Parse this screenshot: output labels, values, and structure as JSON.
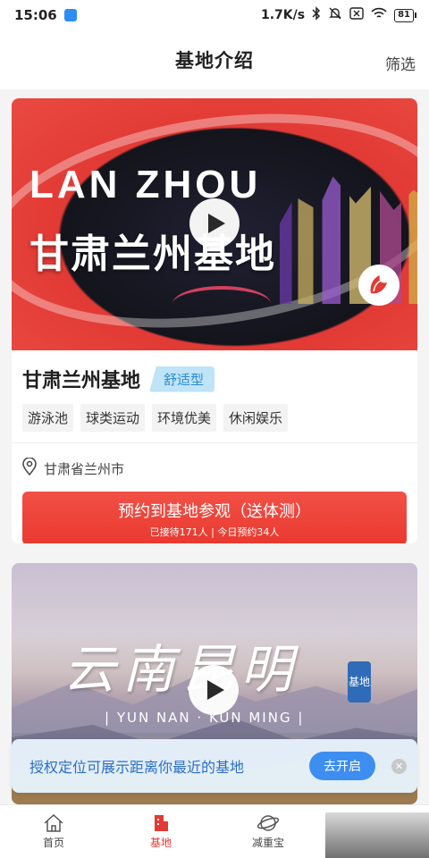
{
  "status_bar": {
    "time": "15:06",
    "net_speed": "1.7K/s",
    "battery": "81"
  },
  "header": {
    "title": "基地介绍",
    "filter_label": "筛选"
  },
  "cards": [
    {
      "image_title_en": "LAN ZHOU",
      "image_title_cn": "甘肃兰州基地",
      "name": "甘肃兰州基地",
      "type_tag": "舒适型",
      "features": [
        "游泳池",
        "球类运动",
        "环境优美",
        "休闲娱乐"
      ],
      "location": "甘肃省兰州市",
      "book_label": "预约到基地参观（送体测）",
      "book_stats": "已接待171人 | 今日预约34人"
    },
    {
      "image_title_cn": "云南昆明",
      "image_title_en": "| YUN NAN · KUN MING |",
      "image_stamp": "基地"
    }
  ],
  "location_prompt": {
    "text": "授权定位可展示距离你最近的基地",
    "button_label": "去开启"
  },
  "bottom_nav": [
    {
      "label": "首页",
      "icon": "home-icon",
      "active": false
    },
    {
      "label": "基地",
      "icon": "building-icon",
      "active": true
    },
    {
      "label": "减重宝",
      "icon": "planet-icon",
      "active": false
    }
  ],
  "colors": {
    "accent_red": "#e9392f",
    "tag_blue": "#2a8bd0",
    "banner_blue": "#3d8ef0"
  }
}
